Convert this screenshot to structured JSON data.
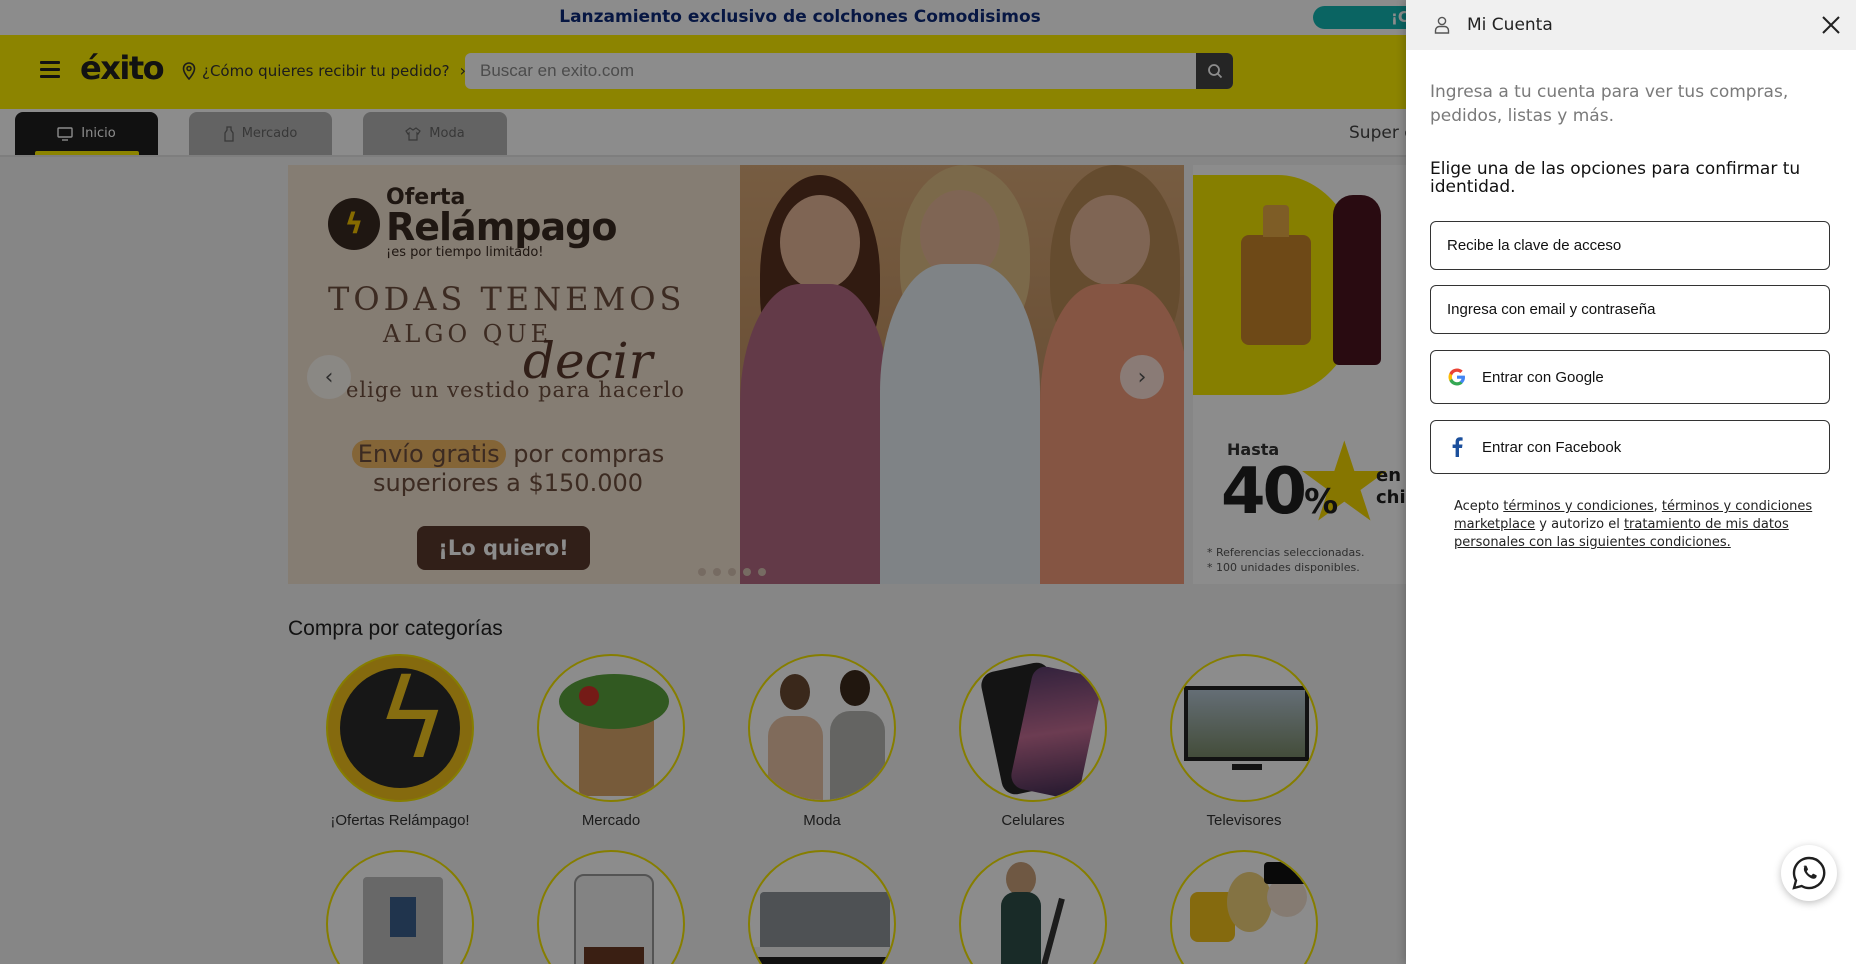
{
  "promo": {
    "text": "Lanzamiento exclusivo de colchones Comodisimos",
    "pill": "¡C"
  },
  "header": {
    "logo": "éxito",
    "delivery": "¿Cómo quieres recibir tu pedido?",
    "search_placeholder": "Buscar en exito.com"
  },
  "nav": {
    "tabs": [
      {
        "label": "Inicio",
        "icon": "monitor-icon"
      },
      {
        "label": "Mercado",
        "icon": "bottle-icon"
      },
      {
        "label": "Moda",
        "icon": "shirt-icon"
      }
    ],
    "right_link": "Super c"
  },
  "banner": {
    "oferta_line1": "Oferta",
    "oferta_line2": "Relámpago",
    "oferta_tag": "¡es por tiempo limitado!",
    "head1": "TODAS TENEMOS",
    "head2": "ALGO QUE",
    "head3": "decir",
    "head4": "elige un vestido para hacerlo",
    "envio_hl": "Envío gratis",
    "envio_rest": "por compras superiores a $150.000",
    "cta": "¡Lo quiero!"
  },
  "banner2": {
    "hasta": "Hasta",
    "percent": "40",
    "percent_sign": "%",
    "en": "en v",
    "chic": "chic",
    "ref1": "* Referencias seleccionadas.",
    "ref2": "* 100 unidades disponibles."
  },
  "categories": {
    "title": "Compra por categorías",
    "items": [
      {
        "label": "¡Ofertas Relámpago!"
      },
      {
        "label": "Mercado"
      },
      {
        "label": "Moda"
      },
      {
        "label": "Celulares"
      },
      {
        "label": "Televisores"
      }
    ]
  },
  "drawer": {
    "title": "Mi Cuenta",
    "intro": "Ingresa a tu cuenta para ver tus compras, pedidos, listas y más.",
    "ask": "Elige una de las opciones para confirmar tu identidad.",
    "options": {
      "access_code": "Recibe la clave de acceso",
      "email": "Ingresa con email y contraseña",
      "google": "Entrar con Google",
      "facebook": "Entrar con Facebook"
    },
    "terms": {
      "t1": "Acepto ",
      "link1": "términos y condiciones",
      "t2": ", ",
      "link2": "términos y condiciones marketplace",
      "t3": " y autorizo el ",
      "link3": "tratamiento de mis datos personales con las siguientes condiciones."
    }
  },
  "colors": {
    "brand_yellow": "#fff000",
    "promo_text": "#0d2b7a",
    "overlay": "rgba(0,0,0,0.45)"
  }
}
